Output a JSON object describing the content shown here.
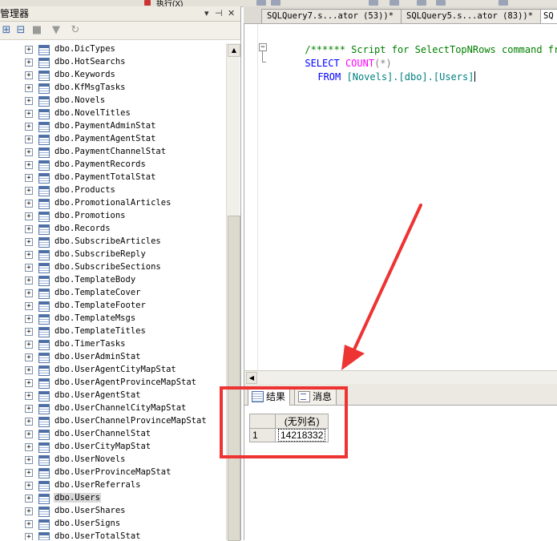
{
  "toolbar": {
    "partial_label": "执行(X)"
  },
  "object_explorer": {
    "title": "管理器",
    "items": [
      "dbo.DicTypes",
      "dbo.HotSearchs",
      "dbo.Keywords",
      "dbo.KfMsgTasks",
      "dbo.Novels",
      "dbo.NovelTitles",
      "dbo.PaymentAdminStat",
      "dbo.PaymentAgentStat",
      "dbo.PaymentChannelStat",
      "dbo.PaymentRecords",
      "dbo.PaymentTotalStat",
      "dbo.Products",
      "dbo.PromotionalArticles",
      "dbo.Promotions",
      "dbo.Records",
      "dbo.SubscribeArticles",
      "dbo.SubscribeReply",
      "dbo.SubscribeSections",
      "dbo.TemplateBody",
      "dbo.TemplateCover",
      "dbo.TemplateFooter",
      "dbo.TemplateMsgs",
      "dbo.TemplateTitles",
      "dbo.TimerTasks",
      "dbo.UserAdminStat",
      "dbo.UserAgentCityMapStat",
      "dbo.UserAgentProvinceMapStat",
      "dbo.UserAgentStat",
      "dbo.UserChannelCityMapStat",
      "dbo.UserChannelProvinceMapStat",
      "dbo.UserChannelStat",
      "dbo.UserCityMapStat",
      "dbo.UserNovels",
      "dbo.UserProvinceMapStat",
      "dbo.UserReferrals",
      "dbo.Users",
      "dbo.UserShares",
      "dbo.UserSigns",
      "dbo.UserTotalStat"
    ],
    "selected_index": 35
  },
  "tabs": [
    {
      "label": "SQLQuery7.s...ator (53))*"
    },
    {
      "label": "SQLQuery5.s...ator (83))*"
    },
    {
      "label": "SQ"
    }
  ],
  "editor": {
    "comment": "/****** Script for SelectTopNRows command from",
    "select_kw": "SELECT",
    "count_fn": "COUNT",
    "count_args": "(*)",
    "from_kw": "FROM",
    "table_ref": "[Novels].[dbo].[Users]"
  },
  "results": {
    "tab_results": "结果",
    "tab_messages": "消息",
    "column_header": "(无列名)",
    "row_number": "1",
    "value": "14218332"
  },
  "annotation_color": "#ee3333"
}
